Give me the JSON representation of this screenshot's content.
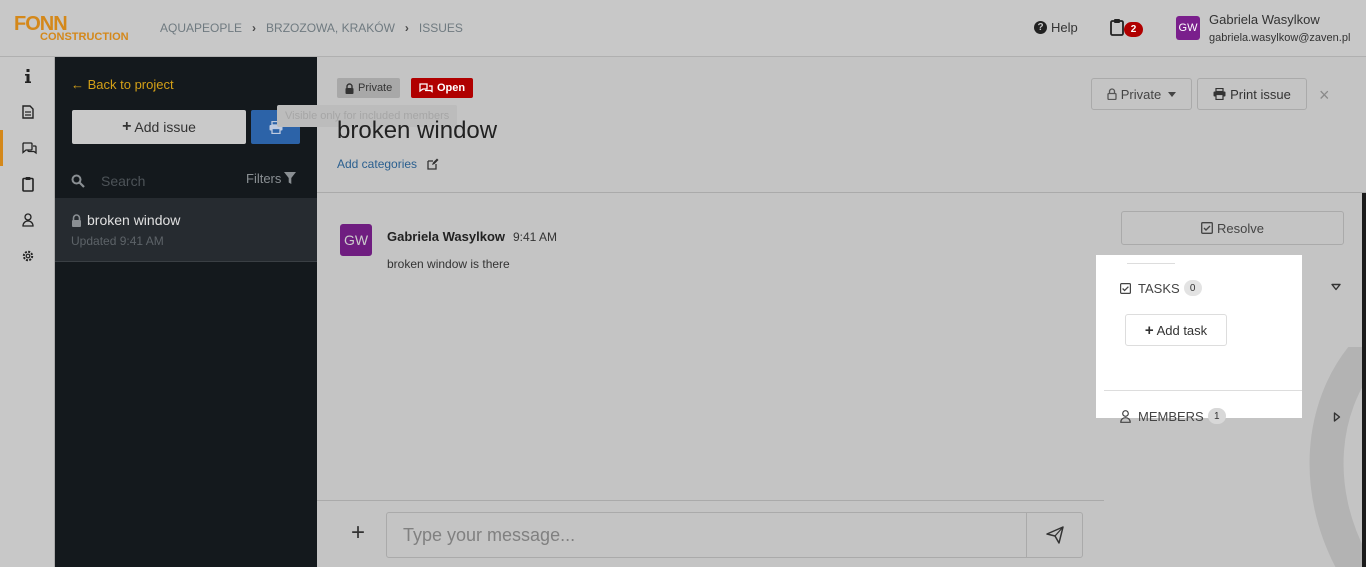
{
  "logo": {
    "line1": "FONN",
    "line2": "CONSTRUCTION"
  },
  "breadcrumb": [
    "AQUAPEOPLE",
    "BRZOZOWA, KRAKÓW",
    "ISSUES"
  ],
  "header": {
    "help_label": "Help",
    "clipboard_badge": "2",
    "user": {
      "initials": "GW",
      "name": "Gabriela Wasylkow",
      "email": "gabriela.wasylkow@zaven.pl"
    }
  },
  "rail": {
    "icons": [
      "info-icon",
      "document-icon",
      "chat-icon",
      "clipboard-icon",
      "user-icon",
      "gear-icon"
    ],
    "active": "chat-icon"
  },
  "sidebar": {
    "back_label": "← Back to project",
    "add_issue_label": "Add issue",
    "search_placeholder": "Search",
    "filters_label": "Filters",
    "issues": [
      {
        "title": "broken window",
        "updated": "Updated 9:41 AM"
      }
    ]
  },
  "issue": {
    "private_badge": "Private",
    "open_badge": "Open",
    "tooltip": "Visible only for included members",
    "title": "broken window",
    "add_categories": "Add categories",
    "private_dropdown": "Private",
    "print_label": "Print issue",
    "close": "×"
  },
  "messages": [
    {
      "initials": "GW",
      "author": "Gabriela Wasylkow",
      "time": "9:41 AM",
      "text": "broken window is there"
    }
  ],
  "composer": {
    "placeholder": "Type your message..."
  },
  "panel": {
    "resolve_label": "Resolve",
    "tasks_label": "TASKS",
    "tasks_count": "0",
    "add_task_label": "Add task",
    "members_label": "MEMBERS",
    "members_count": "1"
  },
  "colors": {
    "accent": "#d4881a",
    "danger": "#b00000",
    "primary": "#2c63a8",
    "avatar": "#7a1f8c"
  }
}
